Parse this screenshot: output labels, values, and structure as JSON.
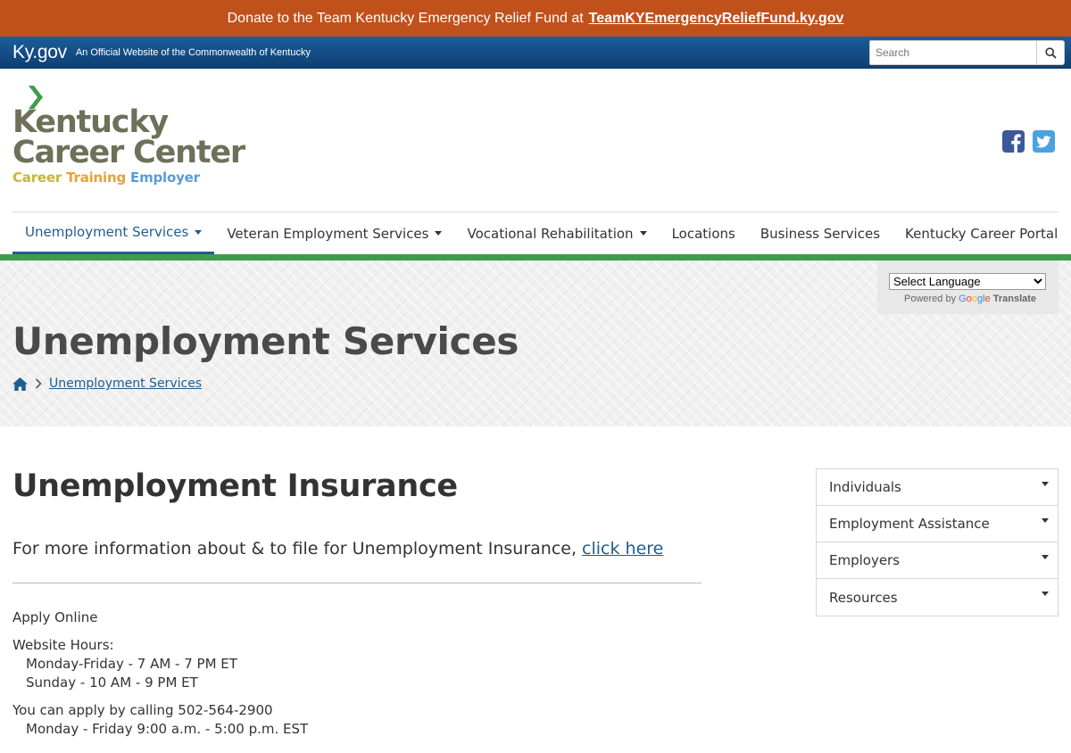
{
  "donate": {
    "text": "Donate to the Team Kentucky Emergency Relief Fund at",
    "link": "TeamKYEmergencyReliefFund.ky.gov"
  },
  "kygov": {
    "logo": "Ky.gov",
    "tagline": "An Official Website of the Commonwealth of Kentucky",
    "search_placeholder": "Search"
  },
  "brand": {
    "line1": "Kentucky",
    "line2": "Career Center",
    "sub_career": "Career",
    "sub_training": "Training",
    "sub_employer": "Employer"
  },
  "nav": {
    "items": [
      {
        "label": "Unemployment Services",
        "dropdown": true,
        "active": true
      },
      {
        "label": "Veteran Employment Services",
        "dropdown": true
      },
      {
        "label": "Vocational Rehabilitation",
        "dropdown": true
      },
      {
        "label": "Locations"
      },
      {
        "label": "Business Services"
      },
      {
        "label": "Kentucky Career Portal"
      }
    ]
  },
  "translate": {
    "select": "Select Language",
    "powered": "Powered by",
    "translate": "Translate"
  },
  "hero": {
    "title": "Unemployment Services",
    "breadcrumb": "Unemployment Services"
  },
  "main": {
    "title": "Unemployment Insurance",
    "lead_text": "For more information about & to file for Unemployment Insurance,",
    "lead_link": "click here",
    "apply_online": "Apply Online",
    "website_hours": "Website Hours:",
    "hours_weekday": "Monday-Friday - 7 AM - 7 PM ET",
    "hours_sunday": "Sunday - 10 AM - 9 PM ET",
    "phone_line": "You can apply by calling 502-564-2900",
    "phone_hours": "Monday - Friday 9:00 a.m. - 5:00 p.m. EST"
  },
  "sidebar": {
    "items": [
      "Individuals",
      "Employment Assistance",
      "Employers",
      "Resources"
    ]
  },
  "colors": {
    "donate": "#c0511b",
    "kygov": "#1c5d99",
    "accent": "#1f5d8f",
    "green": "#3f9d4a"
  }
}
